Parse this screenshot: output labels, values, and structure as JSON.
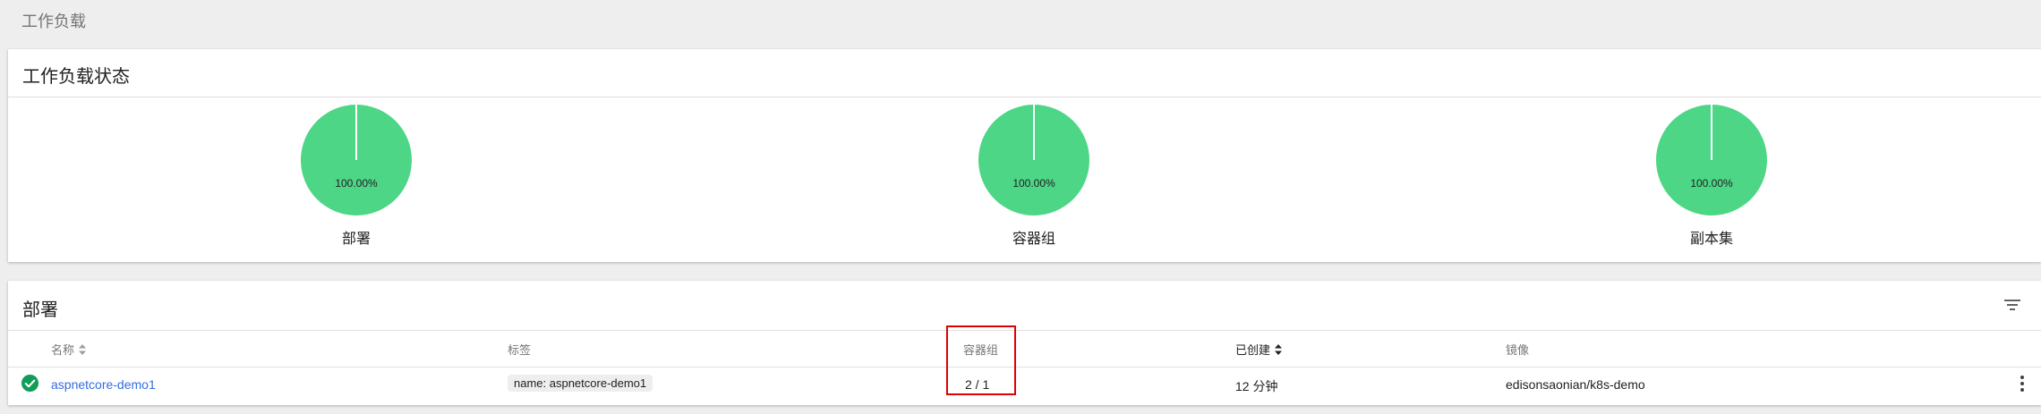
{
  "breadcrumb": {
    "title": "工作负载"
  },
  "status_card": {
    "title": "工作负载状态",
    "charts": [
      {
        "label": "部署",
        "percent_text": "100.00%",
        "running_fraction": 1.0,
        "color": "#4cd686"
      },
      {
        "label": "容器组",
        "percent_text": "100.00%",
        "running_fraction": 1.0,
        "color": "#4cd686"
      },
      {
        "label": "副本集",
        "percent_text": "100.00%",
        "running_fraction": 1.0,
        "color": "#4cd686"
      }
    ]
  },
  "deploy_card": {
    "title": "部署",
    "filter_icon": "filter-list-icon",
    "columns": {
      "name": "名称",
      "labels": "标签",
      "pods": "容器组",
      "created": "已创建",
      "images": "镜像"
    },
    "rows": [
      {
        "status_icon": "check-circle-icon",
        "status_color": "#0f9d58",
        "name": "aspnetcore-demo1",
        "label": "name: aspnetcore-demo1",
        "pods": "2 / 1",
        "created": "12 分钟",
        "image": "edisonsaonian/k8s-demo"
      }
    ]
  },
  "colors": {
    "link": "#326de6",
    "highlight": "#e00000",
    "pie_fill": "#4cd686"
  }
}
